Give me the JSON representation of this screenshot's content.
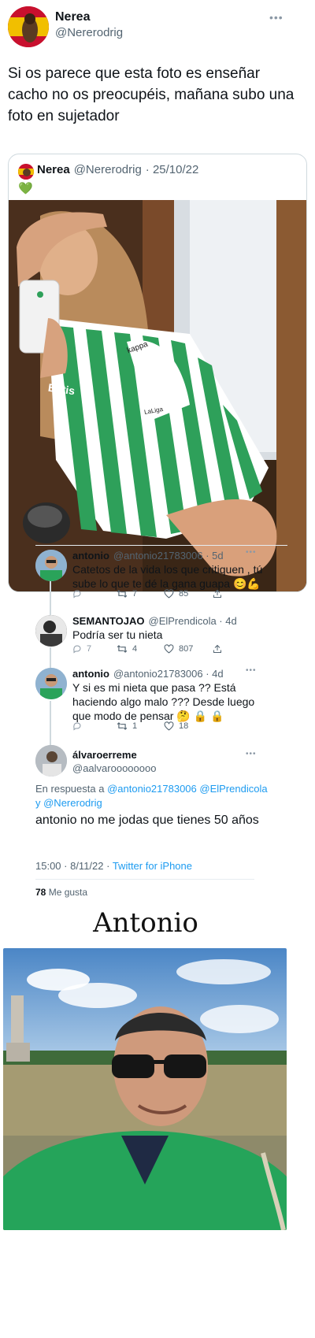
{
  "header": {
    "name": "Nerea",
    "handle": "@Nererodrig",
    "tweet_text": "Si os parece que esta foto es enseñar cacho no os preocupéis, mañana subo una foto en sujetador"
  },
  "quote": {
    "name": "Nerea",
    "handle": "@Nererodrig",
    "date": "· 25/10/22",
    "emoji": "💚"
  },
  "photo_text": {
    "brand": "Betis",
    "sponsor": "LaLiga",
    "kappa": "kappa"
  },
  "replies": [
    {
      "name": "antonio",
      "handle": "@antonio21783006 · 5d",
      "text": "Catetos de la vida los que critiquen , tú sube lo que te dé la gana guapa 😊💪",
      "replies": "",
      "retweets": "7",
      "likes": "85"
    },
    {
      "name": "SEMANTOJAO",
      "handle": "@ElPrendicola · 4d",
      "text": "Podría ser tu nieta",
      "replies": "7",
      "retweets": "4",
      "likes": "807"
    },
    {
      "name": "antonio",
      "handle": "@antonio21783006 · 4d",
      "text": "Y si es mi nieta que pasa ?? Está haciendo algo malo ??? Desde luego que modo de pensar 🤔 🔒 🔒",
      "replies": "",
      "retweets": "1",
      "likes": "18"
    }
  ],
  "main_reply": {
    "name": "álvaroerreme",
    "handle": "@aalvaroooooooo",
    "reply_prefix": "En respuesta a",
    "reply_to": "@antonio21783006 @ElPrendicola y @Nererodrig",
    "text": "antonio no me jodas que tienes 50 años",
    "time": "15:00 · 8/11/22 ·",
    "source": "Twitter for iPhone",
    "likes_count": "78",
    "likes_label": "Me gusta"
  },
  "caption": "Antonio",
  "colors": {
    "link": "#1d9bf0",
    "muted": "#536471",
    "border": "#cfd9de",
    "betis_green": "#1f9b50",
    "shirt_green": "#2ea05a"
  },
  "icons": {
    "more": "ellipsis-icon",
    "reply": "reply-icon",
    "retweet": "retweet-icon",
    "like": "heart-icon",
    "share": "share-icon"
  }
}
